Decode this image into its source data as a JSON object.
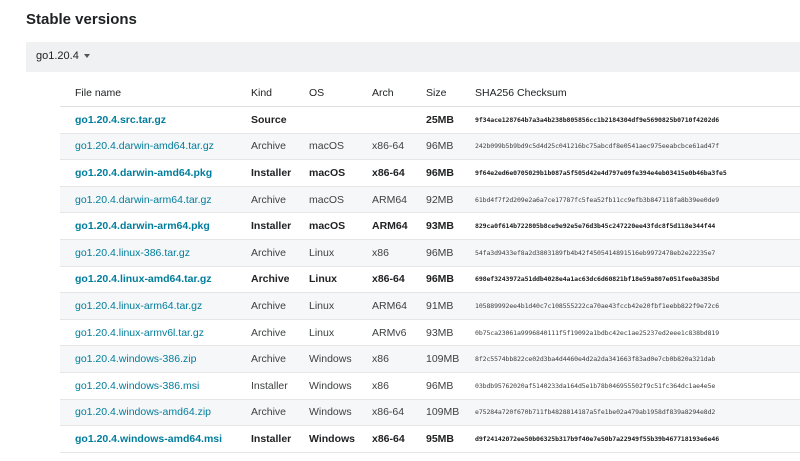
{
  "heading": "Stable versions",
  "version_selector": {
    "label": "go1.20.4"
  },
  "table": {
    "headers": [
      "File name",
      "Kind",
      "OS",
      "Arch",
      "Size",
      "SHA256 Checksum"
    ],
    "rows": [
      {
        "file": "go1.20.4.src.tar.gz",
        "kind": "Source",
        "os": "",
        "arch": "",
        "size": "25MB",
        "sha": "9f34ace128764b7a3a4b238b805856cc1b2184304df9e5690825b0710f4202d6",
        "featured": true
      },
      {
        "file": "go1.20.4.darwin-amd64.tar.gz",
        "kind": "Archive",
        "os": "macOS",
        "arch": "x86-64",
        "size": "96MB",
        "sha": "242b099b5b9bd9c5d4d25c041216bc75abcdf8e0541aec975eeabcbce61ad47f",
        "featured": false
      },
      {
        "file": "go1.20.4.darwin-amd64.pkg",
        "kind": "Installer",
        "os": "macOS",
        "arch": "x86-64",
        "size": "96MB",
        "sha": "9f64e2ed6e0705029b1b087a5f505d42e4d797e09fe394e4eb03415e0b46ba3fe5",
        "featured": true
      },
      {
        "file": "go1.20.4.darwin-arm64.tar.gz",
        "kind": "Archive",
        "os": "macOS",
        "arch": "ARM64",
        "size": "92MB",
        "sha": "61bd4f7f2d209e2a6a7ce17787fc5fea52fb11cc9efb3b847118fa8b39ee0de9",
        "featured": false
      },
      {
        "file": "go1.20.4.darwin-arm64.pkg",
        "kind": "Installer",
        "os": "macOS",
        "arch": "ARM64",
        "size": "93MB",
        "sha": "829ca0f614b722805b8ce9e92e5e76d3b45c247220ee43fdc8f5d118e344f44",
        "featured": true
      },
      {
        "file": "go1.20.4.linux-386.tar.gz",
        "kind": "Archive",
        "os": "Linux",
        "arch": "x86",
        "size": "96MB",
        "sha": "54fa3d9433ef8a2d3803189fb4b42f4505414891516eb9972478eb2e22235e7",
        "featured": false
      },
      {
        "file": "go1.20.4.linux-amd64.tar.gz",
        "kind": "Archive",
        "os": "Linux",
        "arch": "x86-64",
        "size": "96MB",
        "sha": "698ef3243972a51ddb4028e4a1ac63dc6d60821bf18e59a807e051fee0a385bd",
        "featured": true
      },
      {
        "file": "go1.20.4.linux-arm64.tar.gz",
        "kind": "Archive",
        "os": "Linux",
        "arch": "ARM64",
        "size": "91MB",
        "sha": "105889992ee4b1d40c7c108555222ca70ae43fccb42e20fbf1eebb822f9e72c6",
        "featured": false
      },
      {
        "file": "go1.20.4.linux-armv6l.tar.gz",
        "kind": "Archive",
        "os": "Linux",
        "arch": "ARMv6",
        "size": "93MB",
        "sha": "0b75ca23061a9996840111f5f19092a1bdbc42ec1ae25237ed2eee1c838bd819",
        "featured": false
      },
      {
        "file": "go1.20.4.windows-386.zip",
        "kind": "Archive",
        "os": "Windows",
        "arch": "x86",
        "size": "109MB",
        "sha": "8f2c5574bb822ce02d3ba4d4460e4d2a2da341663f83ad0e7cb0b820a321dab",
        "featured": false
      },
      {
        "file": "go1.20.4.windows-386.msi",
        "kind": "Installer",
        "os": "Windows",
        "arch": "x86",
        "size": "96MB",
        "sha": "03bdb95762020af5140233da164d5e1b78b046955502f9c51fc364dc1ae4e5e",
        "featured": false
      },
      {
        "file": "go1.20.4.windows-amd64.zip",
        "kind": "Archive",
        "os": "Windows",
        "arch": "x86-64",
        "size": "109MB",
        "sha": "e75284a720f670b711fb4828814187a5fe1be02a479ab1958df839a8294e8d2",
        "featured": false
      },
      {
        "file": "go1.20.4.windows-amd64.msi",
        "kind": "Installer",
        "os": "Windows",
        "arch": "x86-64",
        "size": "95MB",
        "sha": "d9f24142072ee50b06325b317b9f40e7e50b7a22949f55b39b467718193e6e46",
        "featured": true
      }
    ]
  }
}
